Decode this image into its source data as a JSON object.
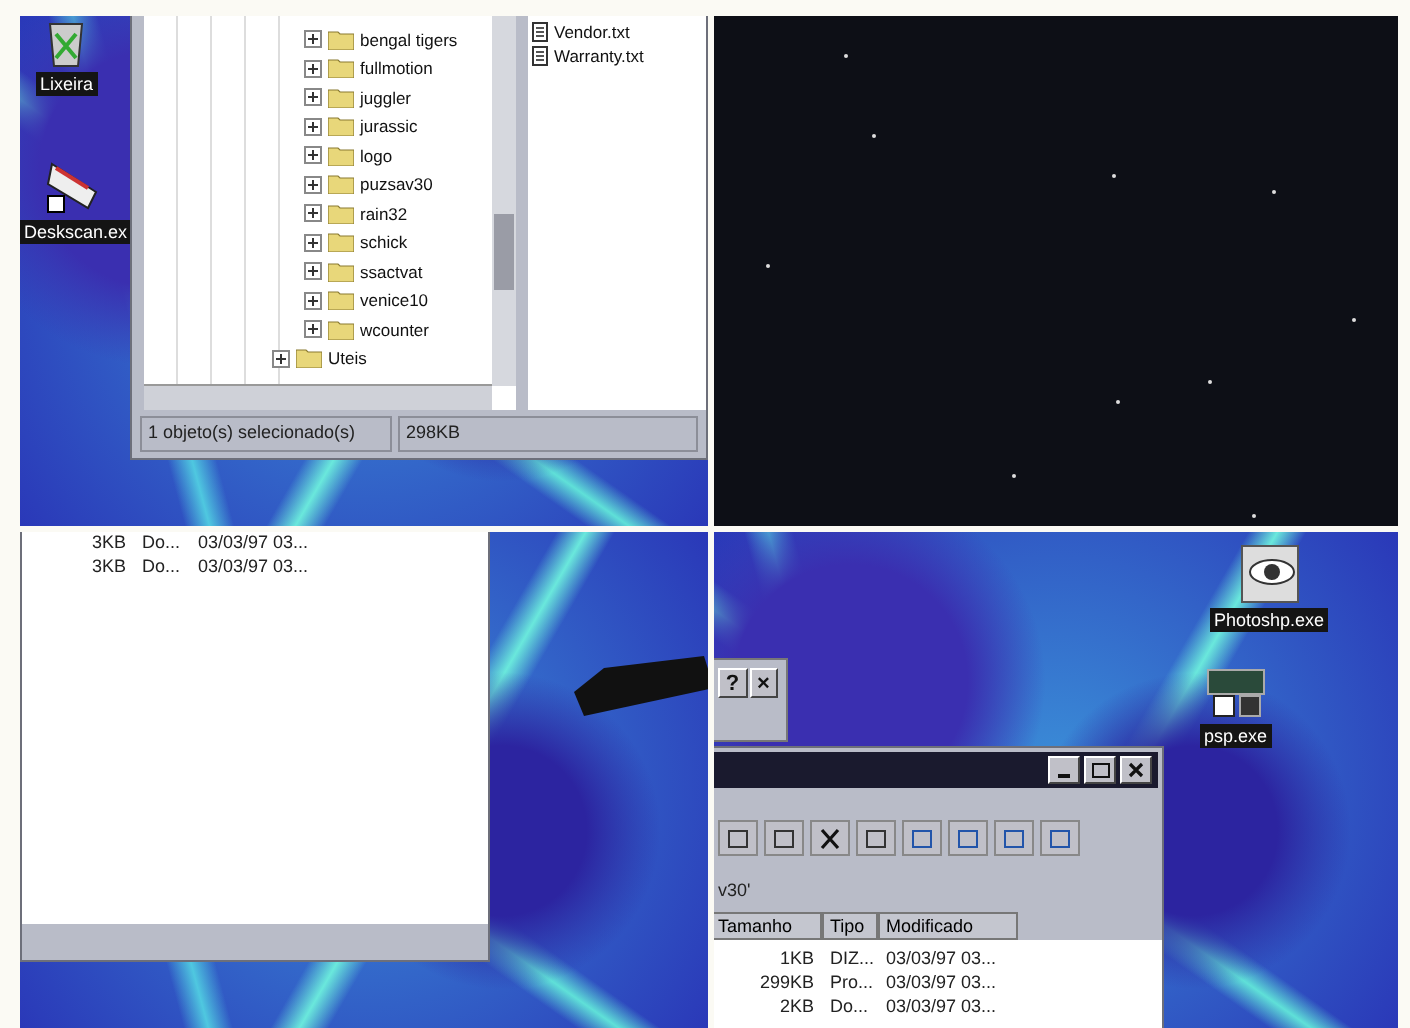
{
  "screen_1": {
    "desktop_icons": [
      {
        "label": "Lixeira",
        "kind": "bin"
      },
      {
        "label": "Deskscan.ex",
        "kind": "scanner"
      }
    ],
    "tree": {
      "subfolders": [
        {
          "label": "bengal tigers"
        },
        {
          "label": "fullmotion"
        },
        {
          "label": "juggler"
        },
        {
          "label": "jurassic"
        },
        {
          "label": "logo"
        },
        {
          "label": "puzsav30"
        },
        {
          "label": "rain32"
        },
        {
          "label": "schick"
        },
        {
          "label": "ssactvat"
        },
        {
          "label": "venice10"
        },
        {
          "label": "wcounter"
        }
      ],
      "folders": [
        {
          "label": "Uteis"
        }
      ]
    },
    "files": [
      "Vendor.txt",
      "Warranty.txt"
    ],
    "status_bar": [
      "1 objeto(s) selecionado(s)",
      "298KB"
    ]
  },
  "screen_3": {
    "rows": [
      {
        "size": "3KB",
        "type": "Do...",
        "modified": "03/03/97 03..."
      },
      {
        "size": "3KB",
        "type": "Do...",
        "modified": "03/03/97 03..."
      }
    ]
  },
  "screen_4": {
    "desktop_icons": [
      {
        "label": "Photoshp.exe",
        "kind": "eye"
      },
      {
        "label": "psp.exe",
        "kind": "app"
      }
    ],
    "dialog_buttons": [
      "?",
      "×"
    ],
    "address": "v30'",
    "columns": [
      "Tamanho",
      "Tipo",
      "Modificado"
    ],
    "rows": [
      {
        "size": "1KB",
        "type": "DIZ...",
        "modified": "03/03/97 03..."
      },
      {
        "size": "299KB",
        "type": "Pro...",
        "modified": "03/03/97 03..."
      },
      {
        "size": "2KB",
        "type": "Do...",
        "modified": "03/03/97 03..."
      }
    ]
  }
}
